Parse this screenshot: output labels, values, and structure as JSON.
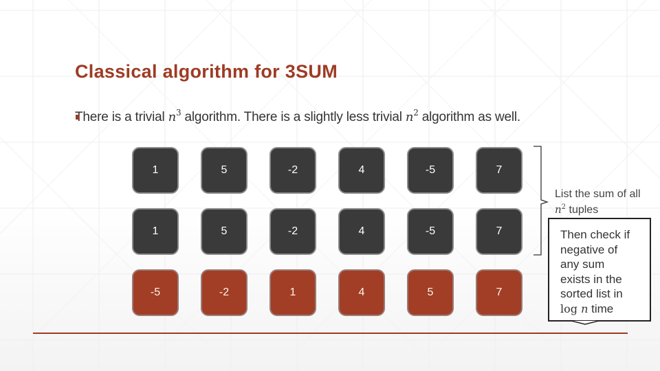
{
  "slide": {
    "title": "Classical algorithm for 3SUM",
    "bullet": {
      "part1": "There is a trivial ",
      "math1_base": "n",
      "math1_exp": "3",
      "part2": " algorithm. There is a slightly less trivial ",
      "math2_base": "n",
      "math2_exp": "2",
      "part3": " algorithm as well."
    },
    "rows": [
      {
        "style": "dark",
        "values": [
          "1",
          "5",
          "-2",
          "4",
          "-5",
          "7"
        ]
      },
      {
        "style": "dark",
        "values": [
          "1",
          "5",
          "-2",
          "4",
          "-5",
          "7"
        ]
      },
      {
        "style": "red",
        "values": [
          "-5",
          "-2",
          "1",
          "4",
          "5",
          "7"
        ]
      }
    ],
    "side_label": {
      "line1": "List the sum of all",
      "math_base": "n",
      "math_exp": "2",
      "line2_rest": " tuples"
    },
    "callout": {
      "text": "Then check if\nnegative of\nany sum\nexists in the\nsorted list in",
      "last_line_log": "log",
      "last_line_n": "n",
      "last_line_rest": " time"
    },
    "colors": {
      "accent": "#9e3b24",
      "tile_dark": "#3a3a3a",
      "tile_red": "#a23e26",
      "text": "#333333"
    }
  }
}
